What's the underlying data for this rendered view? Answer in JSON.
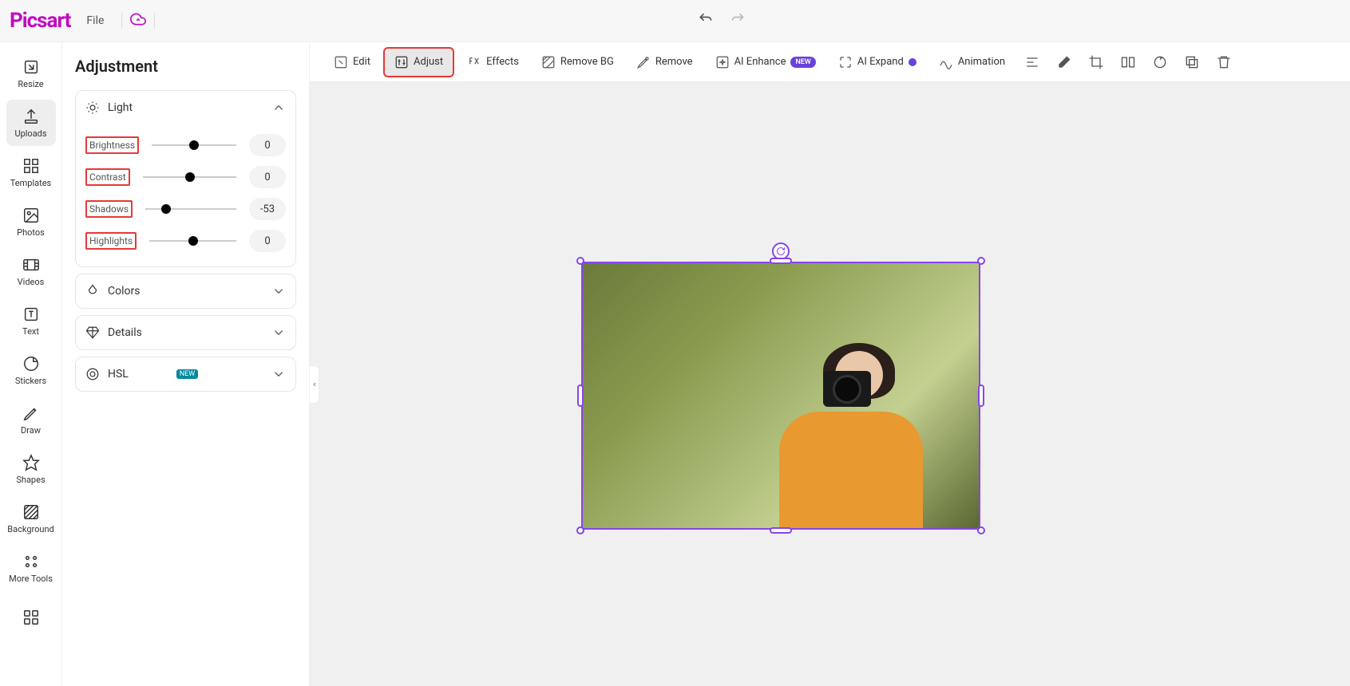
{
  "app": {
    "logo": "Picsart",
    "file_menu": "File"
  },
  "rail": [
    {
      "id": "resize",
      "label": "Resize"
    },
    {
      "id": "uploads",
      "label": "Uploads"
    },
    {
      "id": "templates",
      "label": "Templates"
    },
    {
      "id": "photos",
      "label": "Photos"
    },
    {
      "id": "videos",
      "label": "Videos"
    },
    {
      "id": "text",
      "label": "Text"
    },
    {
      "id": "stickers",
      "label": "Stickers"
    },
    {
      "id": "draw",
      "label": "Draw"
    },
    {
      "id": "shapes",
      "label": "Shapes"
    },
    {
      "id": "background",
      "label": "Background"
    },
    {
      "id": "more",
      "label": "More Tools"
    }
  ],
  "panel": {
    "title": "Adjustment",
    "sections": {
      "light": {
        "label": "Light",
        "sliders": [
          {
            "label": "Brightness",
            "value": "0",
            "pos": 50
          },
          {
            "label": "Contrast",
            "value": "0",
            "pos": 50
          },
          {
            "label": "Shadows",
            "value": "-53",
            "pos": 23
          },
          {
            "label": "Highlights",
            "value": "0",
            "pos": 50
          }
        ]
      },
      "colors": {
        "label": "Colors"
      },
      "details": {
        "label": "Details"
      },
      "hsl": {
        "label": "HSL",
        "badge": "NEW"
      }
    }
  },
  "toolbar": {
    "edit": "Edit",
    "adjust": "Adjust",
    "effects": "Effects",
    "removebg": "Remove BG",
    "remove": "Remove",
    "aienhance": "AI Enhance",
    "aienhance_badge": "NEW",
    "aiexpand": "AI Expand",
    "animation": "Animation"
  }
}
